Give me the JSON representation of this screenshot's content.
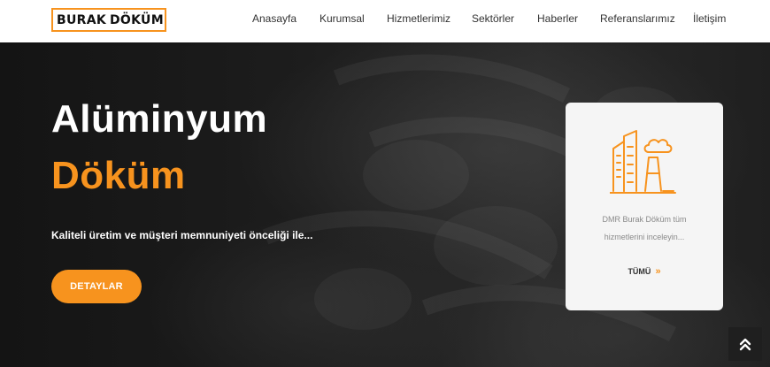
{
  "header": {
    "logo": {
      "left": "BURAK",
      "right": "DÖKÜM"
    },
    "nav": [
      {
        "label": "Anasayfa"
      },
      {
        "label": "Kurumsal"
      },
      {
        "label": "Hizmetlerimiz"
      },
      {
        "label": "Sektörler"
      },
      {
        "label": "Haberler"
      },
      {
        "label": "Referanslarımız"
      },
      {
        "label": "İletişim"
      }
    ]
  },
  "hero": {
    "title_line1": "Alüminyum",
    "title_line2": "Döküm",
    "subtitle": "Kaliteli üretim ve müşteri memnuniyeti önceliği ile...",
    "button_label": "DETAYLAR"
  },
  "card": {
    "icon": "factory-icon",
    "text_line1": "DMR Burak Döküm tüm",
    "text_line2": "hizmetlerini inceleyin...",
    "link_label": "TÜMÜ",
    "link_arrows": "»"
  },
  "scroll_top": {
    "icon": "double-chevron-up-icon",
    "symbol": "⌃"
  },
  "colors": {
    "accent": "#f7931e",
    "header_bg": "#ffffff",
    "hero_bg": "#1a1a1a",
    "card_bg": "#f5f5f5"
  }
}
